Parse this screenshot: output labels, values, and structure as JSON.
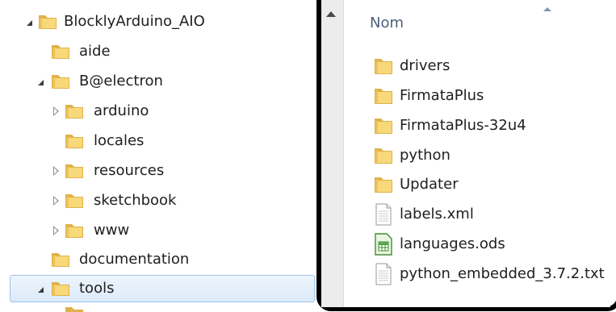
{
  "tree": {
    "items": [
      {
        "label": "BlocklyArduino_AIO",
        "toggle": "expanded",
        "selected": false,
        "icon": "folder-icon"
      },
      {
        "label": "aide",
        "toggle": "none",
        "selected": false,
        "icon": "folder-icon"
      },
      {
        "label": "B@electron",
        "toggle": "expanded",
        "selected": false,
        "icon": "folder-icon"
      },
      {
        "label": "arduino",
        "toggle": "collapsed",
        "selected": false,
        "icon": "folder-icon"
      },
      {
        "label": "locales",
        "toggle": "none",
        "selected": false,
        "icon": "folder-icon"
      },
      {
        "label": "resources",
        "toggle": "collapsed",
        "selected": false,
        "icon": "folder-icon"
      },
      {
        "label": "sketchbook",
        "toggle": "collapsed",
        "selected": false,
        "icon": "folder-icon"
      },
      {
        "label": "www",
        "toggle": "collapsed",
        "selected": false,
        "icon": "folder-icon"
      },
      {
        "label": "documentation",
        "toggle": "none",
        "selected": false,
        "icon": "folder-icon"
      },
      {
        "label": "tools",
        "toggle": "expanded",
        "selected": true,
        "icon": "folder-icon"
      }
    ]
  },
  "file_list": {
    "column_header": "Nom",
    "sort": "ascending",
    "items": [
      {
        "name": "drivers",
        "type": "folder",
        "icon": "folder-icon"
      },
      {
        "name": "FirmataPlus",
        "type": "folder",
        "icon": "folder-icon"
      },
      {
        "name": "FirmataPlus-32u4",
        "type": "folder",
        "icon": "folder-icon"
      },
      {
        "name": "python",
        "type": "folder",
        "icon": "folder-icon"
      },
      {
        "name": "Updater",
        "type": "folder",
        "icon": "folder-icon"
      },
      {
        "name": "labels.xml",
        "type": "xml",
        "icon": "document-icon"
      },
      {
        "name": "languages.ods",
        "type": "ods",
        "icon": "spreadsheet-icon"
      },
      {
        "name": "python_embedded_3.7.2.txt",
        "type": "txt",
        "icon": "text-file-icon"
      }
    ]
  },
  "colors": {
    "selection": "#dbeaf9",
    "selection_border": "#9fc3ea",
    "header_text": "#4c607a",
    "frame": "#000000"
  }
}
